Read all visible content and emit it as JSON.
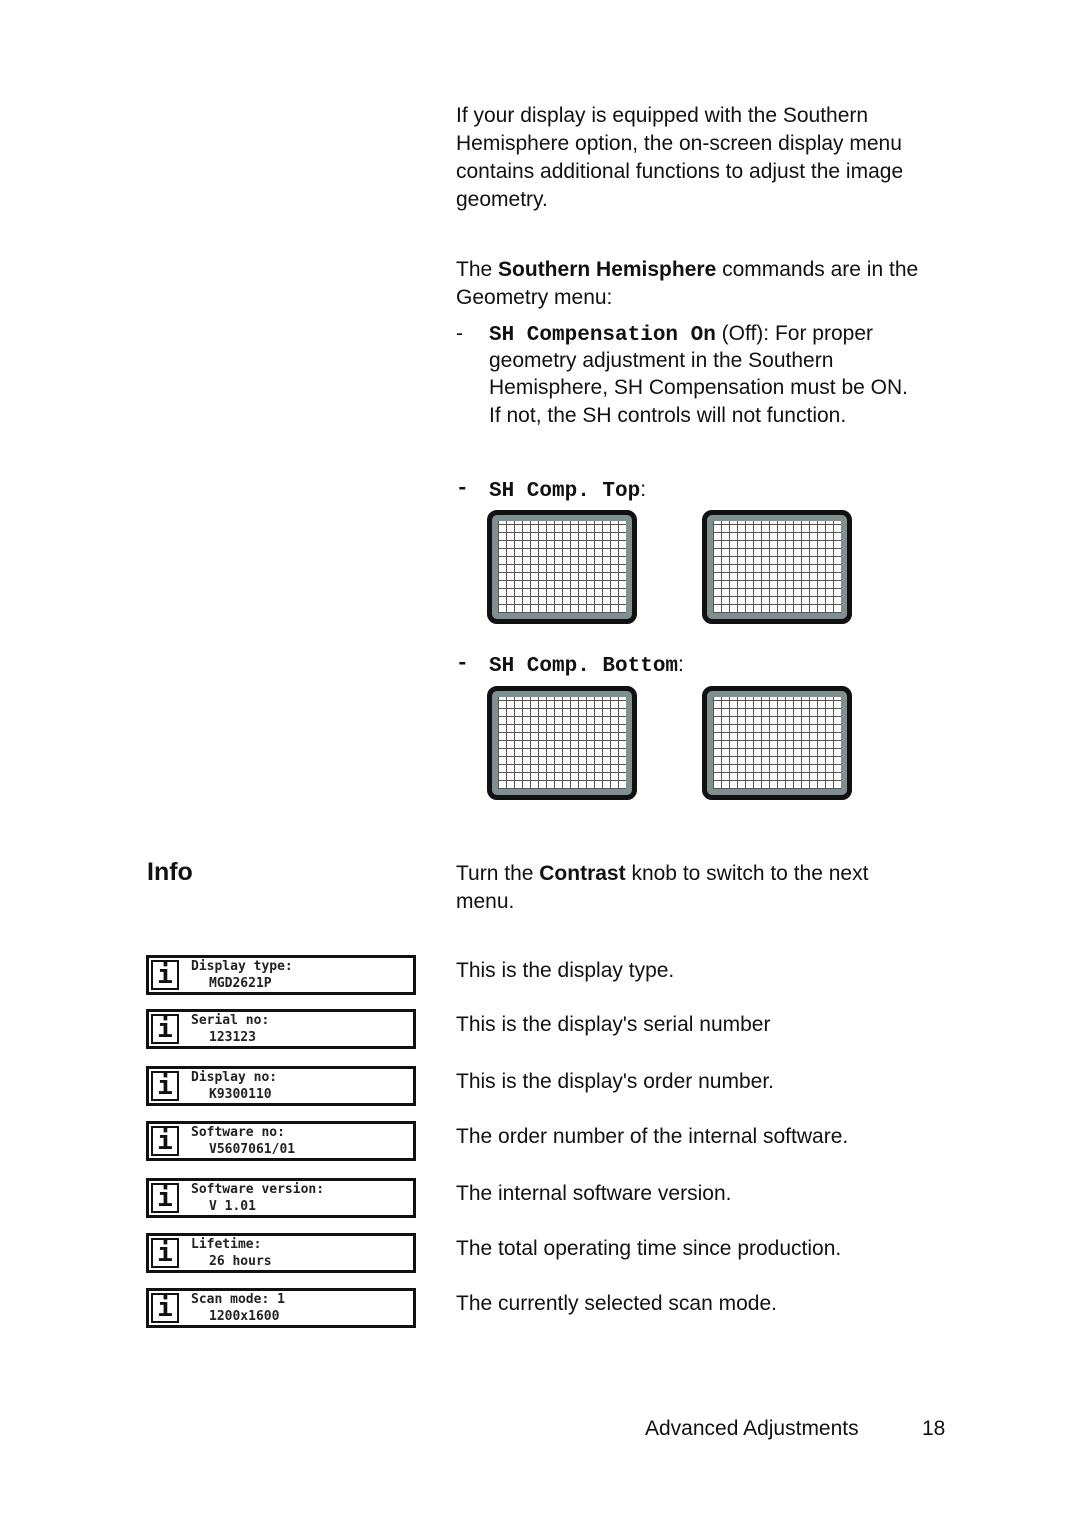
{
  "intro": {
    "lines": [
      "If your display is equipped with the Southern",
      "Hemisphere option, the on-screen display menu",
      "contains additional functions to adjust the image",
      "geometry."
    ]
  },
  "commands": {
    "prefix": "The ",
    "bold": "Southern Hemisphere",
    "suffix": " commands are in the",
    "line2": "Geometry menu:"
  },
  "sh_comp": {
    "dash": "-",
    "code": "SH Compensation On",
    "text": " (Off): For proper",
    "lines": [
      "geometry adjustment in the Southern",
      "Hemisphere, SH Compensation must be ON.",
      "If not, the SH controls will not function."
    ]
  },
  "sh_top": {
    "dash": "-",
    "code": "SH Comp. Top",
    "colon": ":"
  },
  "sh_bottom": {
    "dash": "-",
    "code": "SH Comp. Bottom",
    "colon": ":"
  },
  "info": {
    "heading": "Info",
    "intro_prefix": "Turn the ",
    "intro_bold": "Contrast",
    "intro_suffix": " knob to switch to the next",
    "intro_line2": "menu.",
    "icon": "info-icon",
    "icon_glyph": "i",
    "items": [
      {
        "label": "Display type:",
        "value": "MGD2621P",
        "desc": "This is the display type."
      },
      {
        "label": "Serial no:",
        "value": "123123",
        "desc": "This is the display's serial number"
      },
      {
        "label": "Display no:",
        "value": "K9300110",
        "desc": "This is the display's order number."
      },
      {
        "label": "Software no:",
        "value": "V5607061/01",
        "desc": "The order number of the internal software."
      },
      {
        "label": "Software version:",
        "value": "V 1.01",
        "desc": "The internal software version."
      },
      {
        "label": "Lifetime:",
        "value": "26 hours",
        "desc": "The total operating time since production."
      },
      {
        "label": "Scan mode: 1",
        "value": "1200x1600",
        "desc": "The currently selected scan mode."
      }
    ]
  },
  "footer": {
    "section": "Advanced Adjustments",
    "page": "18"
  }
}
